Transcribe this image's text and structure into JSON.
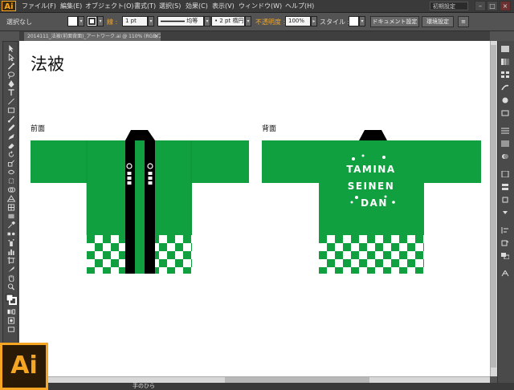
{
  "app": {
    "logo": "Ai",
    "preset": "初期設定"
  },
  "menus": [
    "ファイル(F)",
    "編集(E)",
    "オブジェクト(O)",
    "書式(T)",
    "選択(S)",
    "効果(C)",
    "表示(V)",
    "ウィンドウ(W)",
    "ヘルプ(H)"
  ],
  "control": {
    "selection": "選択なし",
    "stroke_label": "線 :",
    "stroke_weight": "1 pt",
    "profile": "均等",
    "brush": "2 pt 楕円",
    "opacity_label": "不透明度 :",
    "opacity": "100%",
    "style_label": "スタイル :",
    "doc_setup": "ドキュメント設定",
    "prefs": "環境設定"
  },
  "document": {
    "tab": "2014111_法被(前面背面)_アートワーク.ai @ 110% (RGB/プレビュー)",
    "close_symbol": "×",
    "title": "法被",
    "front_label": "前面",
    "back_label": "背面",
    "back_print": [
      "TAMINA",
      "SEINEN",
      "DAN"
    ]
  },
  "status": {
    "tool": "手のひら"
  },
  "colors": {
    "green": "#10a040",
    "black": "#000000",
    "accent": "#f6a623"
  },
  "icons": {
    "window_controls": [
      "minimize-icon",
      "maximize-icon",
      "close-icon"
    ]
  }
}
